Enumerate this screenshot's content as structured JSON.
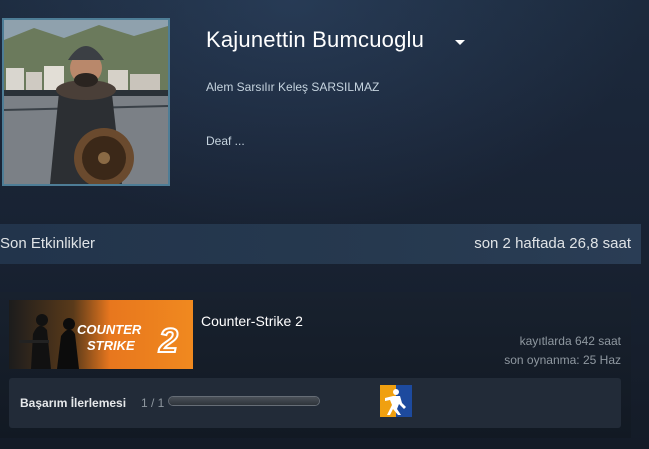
{
  "profile": {
    "persona_name": "Kajunettin Bumcuoglu",
    "real_name": "Alem Sarsılır Keleş SARSILMAZ",
    "summary": "Deaf ..."
  },
  "recent_activity": {
    "title": "Son Etkinlikler",
    "total": "son 2 haftada 26,8 saat"
  },
  "games": [
    {
      "name": "Counter-Strike 2",
      "capsule_text_line1": "COUNTER",
      "capsule_text_line2": "STRIKE",
      "capsule_number": "2",
      "hours_on_record": "kayıtlarda 642 saat",
      "last_played": "son oynanma: 25 Haz",
      "achievement_label": "Başarım İlerlemesi",
      "achievement_count": "1 / 1",
      "achievement_progress": 1
    }
  ],
  "icons": {
    "caret": "caret-down-icon",
    "achievement": "achievement-icon"
  }
}
